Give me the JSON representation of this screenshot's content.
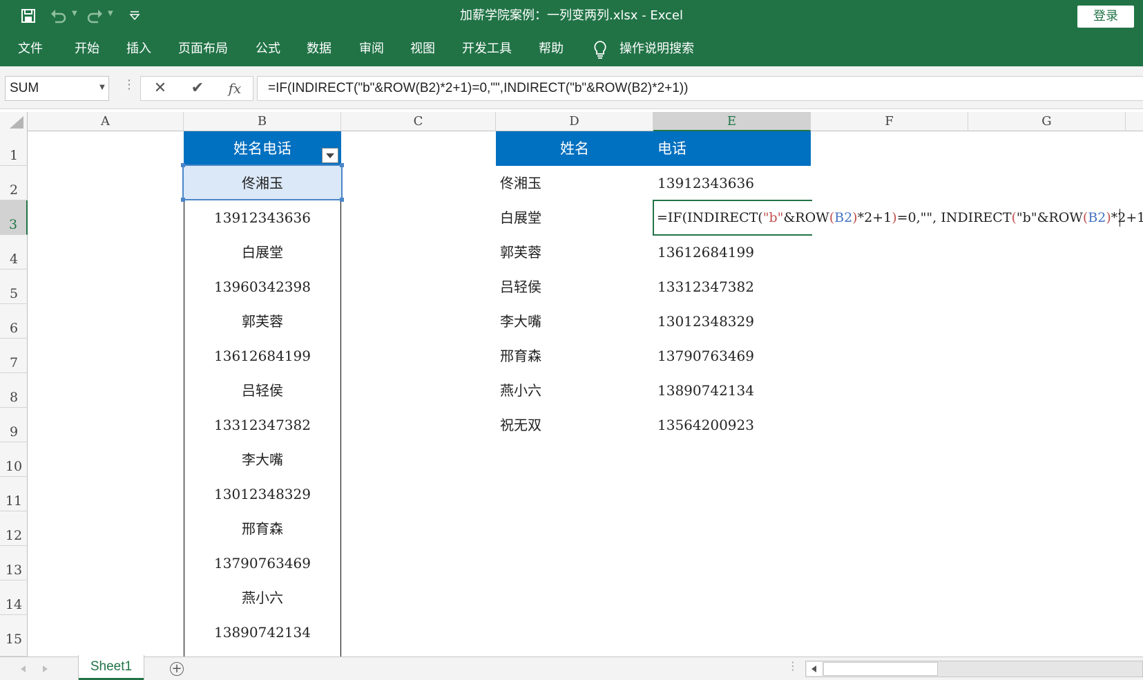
{
  "window": {
    "title": "加薪学院案例：一列变两列.xlsx  -  Excel",
    "login_label": "登录"
  },
  "quick_access": {
    "save_icon": "save-icon",
    "undo_icon": "undo-icon",
    "redo_icon": "redo-icon",
    "customize_icon": "customize-icon"
  },
  "ribbon": {
    "tabs": [
      "文件",
      "开始",
      "插入",
      "页面布局",
      "公式",
      "数据",
      "审阅",
      "视图",
      "开发工具",
      "帮助"
    ],
    "search_label": "操作说明搜索"
  },
  "formula_bar": {
    "name_box": "SUM",
    "cancel_glyph": "✕",
    "enter_glyph": "✔",
    "fx_glyph": "fx",
    "formula": "=IF(INDIRECT(\"b\"&ROW(B2)*2+1)=0,\"\",INDIRECT(\"b\"&ROW(B2)*2+1))"
  },
  "grid": {
    "columns": [
      "A",
      "B",
      "C",
      "D",
      "E",
      "F",
      "G"
    ],
    "selected_column": "E",
    "rows": [
      "1",
      "2",
      "3",
      "4",
      "5",
      "6",
      "7",
      "8",
      "9",
      "10",
      "11",
      "12",
      "13",
      "14",
      "15"
    ],
    "selected_row": "3",
    "column_b": {
      "header": "姓名电话",
      "values": [
        "佟湘玉",
        "13912343636",
        "白展堂",
        "13960342398",
        "郭芙蓉",
        "13612684199",
        "吕轻侯",
        "13312347382",
        "李大嘴",
        "13012348329",
        "邢育森",
        "13790763469",
        "燕小六",
        "13890742134"
      ]
    },
    "table_de": {
      "header_name": "姓名",
      "header_phone": "电话",
      "names": [
        "佟湘玉",
        "白展堂",
        "郭芙蓉",
        "吕轻侯",
        "李大嘴",
        "邢育森",
        "燕小六",
        "祝无双"
      ],
      "phones": [
        "13912343636",
        "",
        "13612684199",
        "13312347382",
        "13012348329",
        "13790763469",
        "13890742134",
        "13564200923"
      ]
    },
    "edit_cell": {
      "t1": "=IF(INDIRECT(",
      "t2": "\"b\"",
      "t3": "&ROW",
      "t4": "(",
      "t5": "B2",
      "t6": ")",
      "t7": "*2+1",
      "t8": ")",
      "t9": "=0,\"\", INDIRECT",
      "t10": "(",
      "t11": "\"b\"&ROW",
      "t12": "(",
      "t13": "B2",
      "t14": ")",
      "t15": "*2+1",
      "t16": ")",
      "t17": ")"
    }
  },
  "sheets": {
    "tabs": [
      "Sheet1"
    ],
    "add_glyph": "+"
  },
  "colors": {
    "excel_green": "#217346",
    "table_header_blue": "#0070c0",
    "selection_blue": "#4a86c8"
  }
}
